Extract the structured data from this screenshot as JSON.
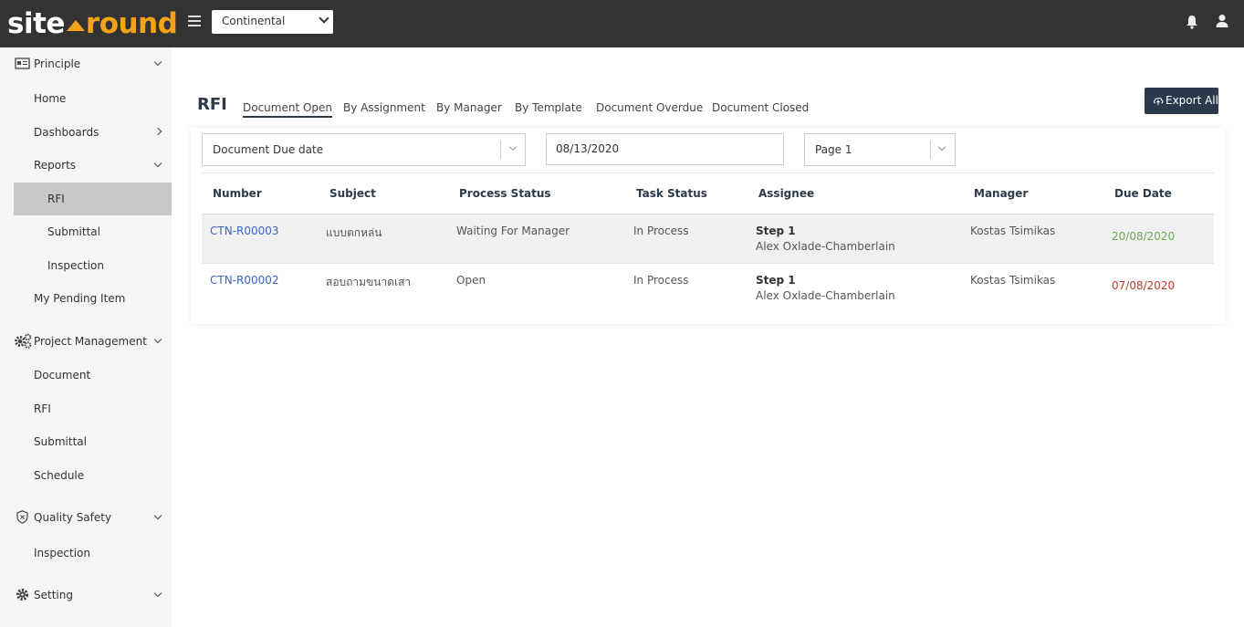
{
  "brand": {
    "logo_left": "site",
    "logo_right": "round",
    "accent_color": "#f5a21b",
    "topbar_color": "#333333"
  },
  "header": {
    "project_select": "Continental"
  },
  "sidebar": {
    "principle": "Principle",
    "home": "Home",
    "dashboards": "Dashboards",
    "reports": "Reports",
    "rfi": "RFI",
    "submittal": "Submittal",
    "inspection": "Inspection",
    "my_pending": "My Pending Item",
    "project_management": "Project Management",
    "pm_document": "Document",
    "pm_rfi": "RFI",
    "pm_submittal": "Submittal",
    "pm_schedule": "Schedule",
    "quality_safety": "Quality Safety",
    "qs_inspection": "Inspection",
    "setting": "Setting"
  },
  "main": {
    "title": "RFI",
    "tabs": [
      "Document Open",
      "By Assignment",
      "By Manager",
      "By Template",
      "Document Overdue",
      "Document Closed"
    ],
    "export_label": "Export All",
    "filters": {
      "date_type": "Document Due date",
      "date": "08/13/2020",
      "page": "Page 1"
    },
    "columns": [
      "Number",
      "Subject",
      "Process Status",
      "Task Status",
      "Assignee",
      "Manager",
      "Due Date"
    ],
    "rows": [
      {
        "number": "CTN-R00003",
        "subject": "แบบตกหล่น",
        "process_status": "Waiting For Manager",
        "task_status": "In Process",
        "step": "Step 1",
        "assignee": "Alex Oxlade-Chamberlain",
        "manager": "Kostas Tsimikas",
        "due_date": "20/08/2020",
        "due_color": "#6aa84f"
      },
      {
        "number": "CTN-R00002",
        "subject": "สอบถามขนาดเสา",
        "process_status": "Open",
        "task_status": "In Process",
        "step": "Step 1",
        "assignee": "Alex Oxlade-Chamberlain",
        "manager": "Kostas Tsimikas",
        "due_date": "07/08/2020",
        "due_color": "#c0392b"
      }
    ]
  }
}
